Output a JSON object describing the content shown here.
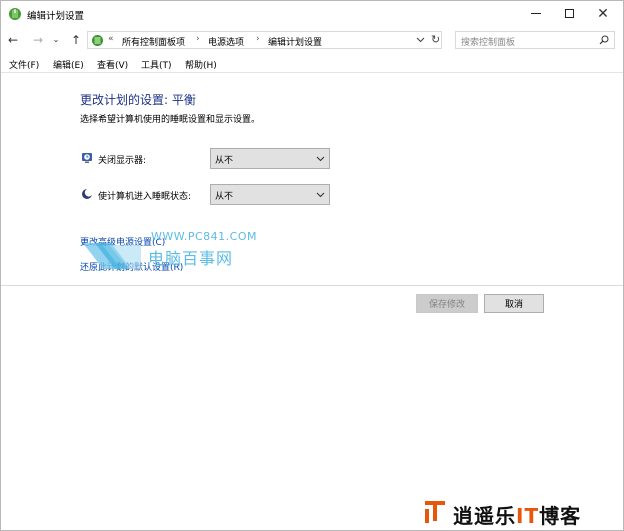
{
  "window": {
    "title": "编辑计划设置",
    "controls": {
      "minimize": "minimize",
      "maximize": "maximize",
      "close": "✕"
    }
  },
  "nav": {
    "back": "←",
    "forward": "→",
    "recent": "⌄",
    "up": "↑",
    "address": {
      "overflow": "«",
      "crumbs": [
        "所有控制面板项",
        "电源选项",
        "编辑计划设置"
      ],
      "separator": "›",
      "refresh": "↻"
    },
    "search": {
      "placeholder": "搜索控制面板"
    }
  },
  "menu": {
    "items": [
      "文件(F)",
      "编辑(E)",
      "查看(V)",
      "工具(T)",
      "帮助(H)"
    ]
  },
  "content": {
    "title": "更改计划的设置: 平衡",
    "subtitle": "选择希望计算机使用的睡眠设置和显示设置。",
    "settings": [
      {
        "label": "关闭显示器:",
        "value": "从不",
        "icon": "display-timer-icon"
      },
      {
        "label": "使计算机进入睡眠状态:",
        "value": "从不",
        "icon": "sleep-moon-icon"
      }
    ],
    "links": {
      "advanced": "更改高级电源设置(C)",
      "restore": "还原此计划的默认设置(R)"
    },
    "buttons": {
      "save": "保存修改",
      "cancel": "取消"
    }
  },
  "watermarks": {
    "site_url": "WWW.PC841.COM",
    "site_name": "电脑百事网",
    "blog_prefix": "逍遥乐",
    "blog_accent": "IT",
    "blog_suffix": "博客"
  },
  "colors": {
    "title_blue": "#1e3287",
    "link_blue": "#0645ad",
    "watermark_blue": "#3fb0e0",
    "blog_orange": "#e8560c"
  }
}
